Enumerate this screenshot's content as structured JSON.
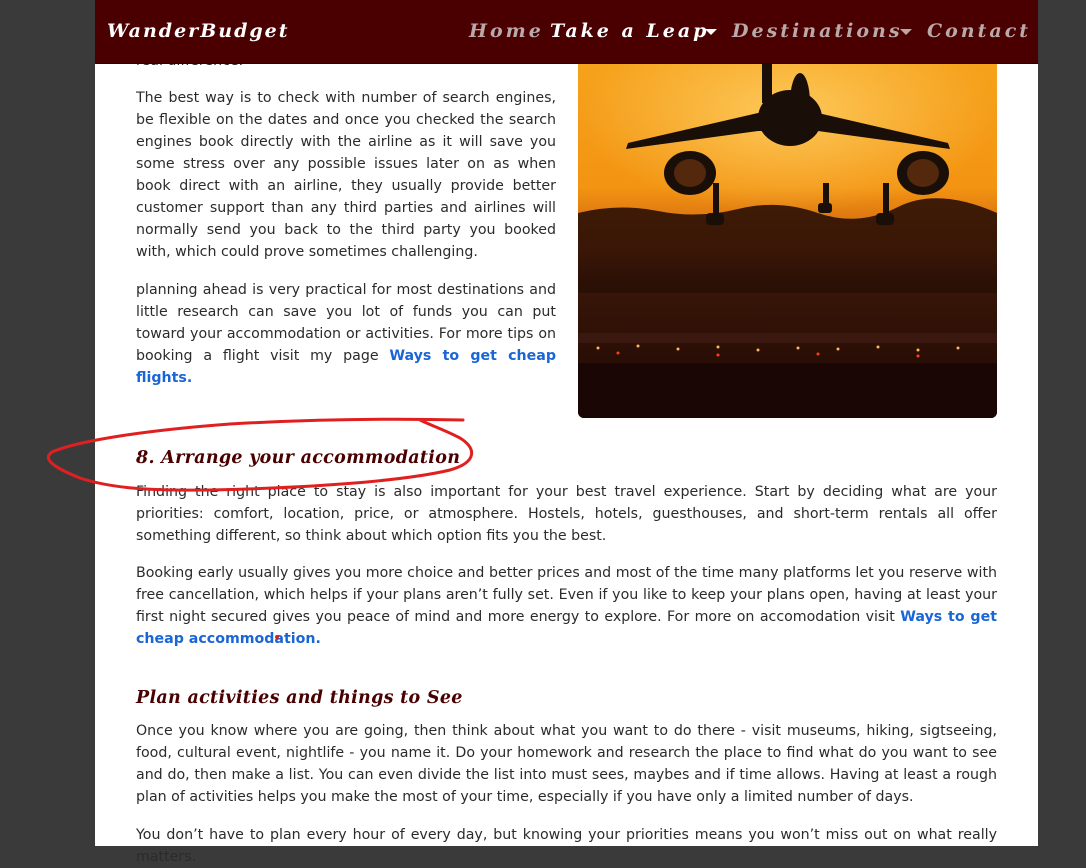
{
  "navbar": {
    "brand": "WanderBudget",
    "items": [
      {
        "label": "Home"
      },
      {
        "label": "Take a Leap"
      },
      {
        "label": "Destinations"
      },
      {
        "label": "Contact"
      }
    ]
  },
  "article": {
    "cut_text": "real difference.",
    "p1": "The best way is to check with number of search engines, be flexible on the dates and once you checked the search engines book directly with the airline as it will save you some stress over any possible issues later on as when book direct with an airline, they usually provide better customer support than any third parties and airlines will normally send you back to the third party you booked with, which could prove sometimes challenging.",
    "p2_text": "planning ahead is very practical for most destinations and little research can save you lot of funds you can put toward your accommodation or activities. For more tips on booking a flight visit my page ",
    "p2_link": "Ways to get cheap flights.",
    "section8": {
      "heading": "8. Arrange your accommodation",
      "p1": "Finding the right place to stay is also important for your best travel experience. Start by deciding what are your priorities: comfort, location, price, or atmosphere. Hostels, hotels, guesthouses, and short-term rentals all offer something different, so think about which option fits you the best.",
      "p2_text": "Booking early usually gives you more choice and better prices and most of the time many platforms let you reserve with free cancellation, which helps if your plans aren’t fully set. Even if you like to keep your plans open, having at least your first night secured gives you peace of mind and more energy to explore. For more on accomodation visit ",
      "p2_link": "Ways to get cheap accommodation."
    },
    "section9": {
      "heading": "Plan activities and things to See",
      "p1": "Once you know where you are going, then think about what you want to do there - visit museums, hiking, sigtseeing, food, cultural event, nightlife - you name it. Do your homework and research the place to find what do you want to see and do, then make a list. You can even divide the list into must sees, maybes and if time allows. Having at least a rough plan of activities helps you make the most of your time, especially if you have only a limited number of days.",
      "p2": "You don’t have to plan every hour of every day, but knowing your priorities means you won’t miss out on what really matters."
    }
  },
  "colors": {
    "navbar_bg": "#4a0000",
    "heading": "#4a0000",
    "link": "#1a66d6",
    "annotation": "#e02020"
  }
}
